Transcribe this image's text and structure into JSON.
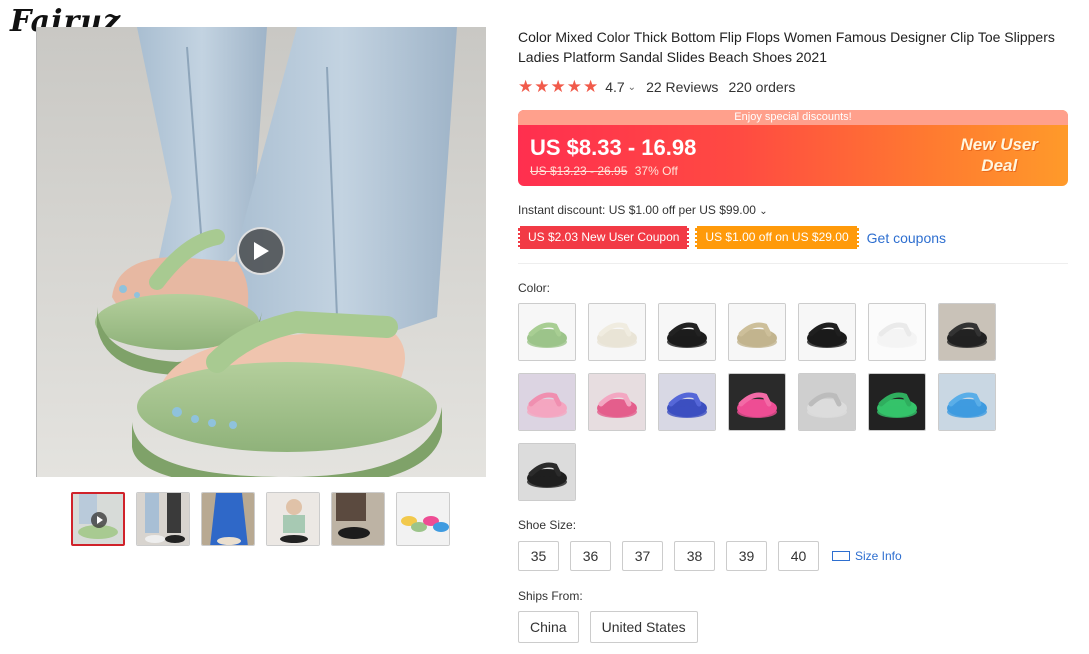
{
  "brand": {
    "logo_text": "Fairuz"
  },
  "gallery": {
    "main_image_alt": "green platform flip flops on feet",
    "play_icon": "play-icon",
    "thumbnails": [
      {
        "name": "video",
        "active": true
      },
      {
        "name": "model-legs"
      },
      {
        "name": "blue-dress"
      },
      {
        "name": "sitting-model"
      },
      {
        "name": "black-pair"
      },
      {
        "name": "color-lineup"
      }
    ]
  },
  "product": {
    "title": "Color Mixed Color Thick Bottom Flip Flops Women Famous Designer Clip Toe Slippers Ladies Platform Sandal Slides Beach Shoes 2021",
    "stars": "★★★★★",
    "rating": "4.7",
    "reviews": "22 Reviews",
    "orders": "220 orders"
  },
  "price": {
    "banner": "Enjoy special discounts!",
    "current": "US $8.33 - 16.98",
    "original": "US $13.23 - 26.95",
    "discount": "37% Off",
    "deal_line1": "New User",
    "deal_line2": "Deal"
  },
  "promotions": {
    "instant": "Instant discount: US $1.00 off per US $99.00",
    "coupon1": "US $2.03 New User Coupon",
    "coupon2": "US $1.00 off on US $29.00",
    "get_coupons": "Get coupons"
  },
  "options": {
    "color_label": "Color:",
    "colors": [
      {
        "name": "green",
        "sole": "#9cc48a",
        "strap": "#a8ce93",
        "bg": "#f7f7f7"
      },
      {
        "name": "cream",
        "sole": "#e9e4d6",
        "strap": "#f0ece0",
        "bg": "#f7f7f7"
      },
      {
        "name": "black",
        "sole": "#1c1c1c",
        "strap": "#222222",
        "bg": "#f7f7f7"
      },
      {
        "name": "khaki",
        "sole": "#c2b48e",
        "strap": "#cdbf9a",
        "bg": "#f7f7f7"
      },
      {
        "name": "black-2",
        "sole": "#1a1a1a",
        "strap": "#1f1f1f",
        "bg": "#f7f7f7"
      },
      {
        "name": "white",
        "sole": "#f4f4f4",
        "strap": "#eaeaea",
        "bg": "#fbfbfb"
      },
      {
        "name": "black-photo",
        "sole": "#222222",
        "strap": "#333333",
        "bg": "#c9c2b8"
      },
      {
        "name": "pink-photo",
        "sole": "#f4a6c0",
        "strap": "#f08fb0",
        "bg": "#dcd4e2"
      },
      {
        "name": "rose-photo",
        "sole": "#e45e8c",
        "strap": "#f3a7c2",
        "bg": "#e7dde0"
      },
      {
        "name": "blue-photo",
        "sole": "#3c4fc0",
        "strap": "#5567d8",
        "bg": "#d8d8e4"
      },
      {
        "name": "hotpink-photo",
        "sole": "#ee4d94",
        "strap": "#f36aa6",
        "bg": "#2a2a2a"
      },
      {
        "name": "grey-photo",
        "sole": "#dcdcdc",
        "strap": "#bcbcbc",
        "bg": "#cfcfcf"
      },
      {
        "name": "green-photo",
        "sole": "#35c36a",
        "strap": "#2fae5e",
        "bg": "#222222"
      },
      {
        "name": "skyblue-photo",
        "sole": "#3f9be0",
        "strap": "#5aaee8",
        "bg": "#c9d7e3"
      },
      {
        "name": "black-pair-photo",
        "sole": "#1f1f1f",
        "strap": "#2b2b2b",
        "bg": "#dcdcdc"
      }
    ],
    "size_label": "Shoe Size:",
    "sizes": [
      "35",
      "36",
      "37",
      "38",
      "39",
      "40"
    ],
    "size_info": "Size Info",
    "ships_label": "Ships From:",
    "ships": [
      "China",
      "United States"
    ]
  }
}
